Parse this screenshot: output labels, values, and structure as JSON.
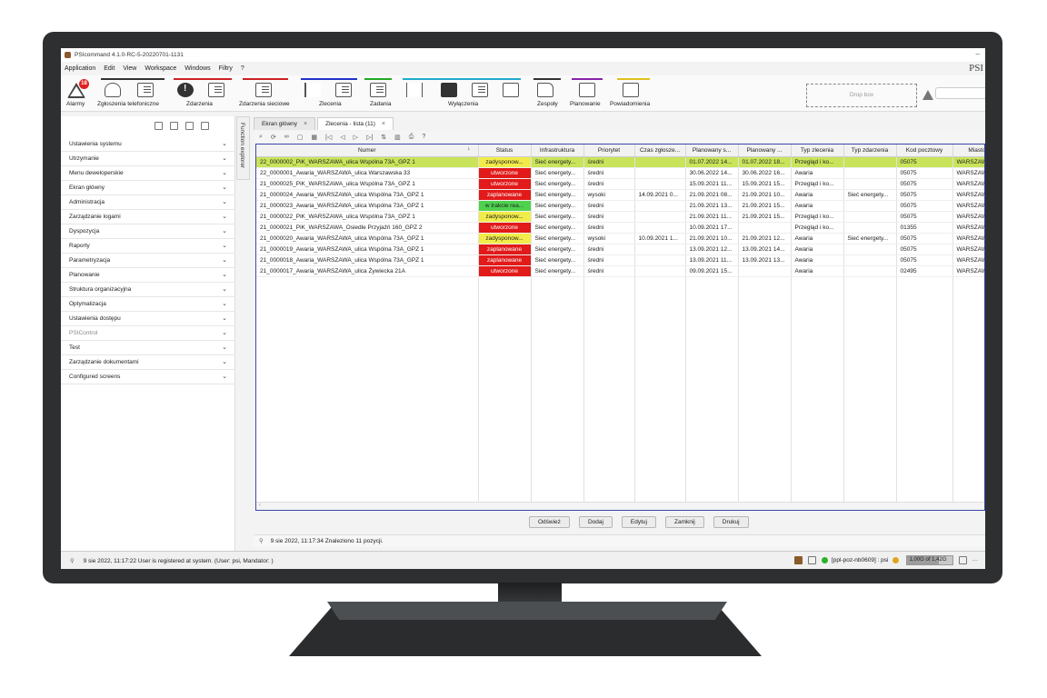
{
  "window": {
    "title": "PSIcommand 4.1.0-RC-5-20220701-1131",
    "brand": "PSI",
    "minimize_glyph": "–"
  },
  "menu": [
    "Application",
    "Edit",
    "View",
    "Workspace",
    "Windows",
    "Filtry",
    "?"
  ],
  "toolbar": {
    "groups": [
      {
        "label": "Alarmy",
        "badge": "18",
        "color": ""
      },
      {
        "label": "Zgłoszenia telefoniczne",
        "color": "#333333"
      },
      {
        "label": "Zdarzenia",
        "color": "#cc2222"
      },
      {
        "label": "Zdarzenia sieciowe",
        "color": "#cc2222"
      },
      {
        "label": "Zlecenia",
        "color": "#2233cc"
      },
      {
        "label": "Zadania",
        "color": "#22aa22"
      },
      {
        "label": "Wyłączenia",
        "color": "#22aacc"
      },
      {
        "label": "Zespoły",
        "color": "#333333"
      },
      {
        "label": "Planowanie",
        "color": "#8822aa"
      },
      {
        "label": "Powiadomienia",
        "color": "#e0c020"
      }
    ],
    "dropbox": "Drop box"
  },
  "sidebar": {
    "explorer_tab": "Function explorer",
    "items": [
      {
        "label": "Ustawienia systemu",
        "disabled": false
      },
      {
        "label": "Utrzymanie",
        "disabled": false
      },
      {
        "label": "Menu deweloperskie",
        "disabled": false
      },
      {
        "label": "Ekran główny",
        "disabled": false
      },
      {
        "label": "Administracja",
        "disabled": false
      },
      {
        "label": "Zarządzanie logami",
        "disabled": false
      },
      {
        "label": "Dyspozycja",
        "disabled": false
      },
      {
        "label": "Raporty",
        "disabled": false
      },
      {
        "label": "Parametryzacja",
        "disabled": false
      },
      {
        "label": "Planowanie",
        "disabled": false
      },
      {
        "label": "Struktura organizacyjna",
        "disabled": false
      },
      {
        "label": "Optymalizacja",
        "disabled": false
      },
      {
        "label": "Ustawienia dostępu",
        "disabled": false
      },
      {
        "label": "PSIControl",
        "disabled": true
      },
      {
        "label": "Test",
        "disabled": false
      },
      {
        "label": "Zarządzanie dokumentami",
        "disabled": false
      },
      {
        "label": "Configured screens",
        "disabled": false
      }
    ]
  },
  "tabs": [
    {
      "label": "Ekran główny",
      "active": false
    },
    {
      "label": "Zlecenia - lista (11)",
      "active": true
    }
  ],
  "table": {
    "sort_glyph": "↓",
    "columns": [
      "Numer",
      "Status",
      "Infrastruktura",
      "Priorytet",
      "Czas zgłosze...",
      "Planowany s...",
      "Planowany ...",
      "Typ zlecenia",
      "Typ zdarzenia",
      "Kod pocztowy",
      "Miasto"
    ],
    "rows": [
      {
        "selected": true,
        "status_class": "st-zadysponowane",
        "cells": [
          "22_0000002_PiK_WARSZAWA_ulica Wspólna 73A_GPZ 1",
          "zadysponow...",
          "Sieć energety...",
          "średni",
          "",
          "01.07.2022 14...",
          "01.07.2022 18...",
          "Przegląd i ko...",
          "",
          "05075",
          "WARSZAWA"
        ]
      },
      {
        "selected": false,
        "status_class": "st-utworzone",
        "cells": [
          "22_0000001_Awaria_WARSZAWA_ulica Warszawska 33",
          "utworzone",
          "Sieć energety...",
          "średni",
          "",
          "30.06.2022 14...",
          "30.06.2022 16...",
          "Awaria",
          "",
          "05075",
          "WARSZAWA"
        ]
      },
      {
        "selected": false,
        "status_class": "st-utworzone",
        "cells": [
          "21_0000025_PiK_WARSZAWA_ulica Wspólna 73A_GPZ 1",
          "utworzone",
          "Sieć energety...",
          "średni",
          "",
          "15.09.2021 11...",
          "15.09.2021 15...",
          "Przegląd i ko...",
          "",
          "05075",
          "WARSZAWA"
        ]
      },
      {
        "selected": false,
        "status_class": "st-zaplanowane",
        "cells": [
          "21_0000024_Awaria_WARSZAWA_ulica Wspólna 73A_GPZ 1",
          "zaplanowane",
          "Sieć energety...",
          "wysoki",
          "14.09.2021 0...",
          "21.09.2021 08...",
          "21.09.2021 10...",
          "Awaria",
          "Sieć energety...",
          "05075",
          "WARSZAWA"
        ]
      },
      {
        "selected": false,
        "status_class": "st-wtrakcie",
        "cells": [
          "21_0000023_Awaria_WARSZAWA_ulica Wspólna 73A_GPZ 1",
          "w trakcie rea...",
          "Sieć energety...",
          "średni",
          "",
          "21.09.2021 13...",
          "21.09.2021 15...",
          "Awaria",
          "",
          "05075",
          "WARSZAWA"
        ]
      },
      {
        "selected": false,
        "status_class": "st-zadysponowane",
        "cells": [
          "21_0000022_PiK_WARSZAWA_ulica Wspólna 73A_GPZ 1",
          "zadysponow...",
          "Sieć energety...",
          "średni",
          "",
          "21.09.2021 11...",
          "21.09.2021 15...",
          "Przegląd i ko...",
          "",
          "05075",
          "WARSZAWA"
        ]
      },
      {
        "selected": false,
        "status_class": "st-utworzone",
        "cells": [
          "21_0000021_PiK_WARSZAWA_Osiedle Przyjaźń 160_GPZ 2",
          "utworzone",
          "Sieć energety...",
          "średni",
          "",
          "10.09.2021 17...",
          "",
          "Przegląd i ko...",
          "",
          "01355",
          "WARSZAWA"
        ]
      },
      {
        "selected": false,
        "status_class": "st-zadysponowane",
        "cells": [
          "21_0000020_Awaria_WARSZAWA_ulica Wspólna 73A_GPZ 1",
          "zadysponow...",
          "Sieć energety...",
          "wysoki",
          "10.09.2021 1...",
          "21.09.2021 10...",
          "21.09.2021 12...",
          "Awaria",
          "Sieć energety...",
          "05075",
          "WARSZAWA"
        ]
      },
      {
        "selected": false,
        "status_class": "st-zaplanowane",
        "cells": [
          "21_0000019_Awaria_WARSZAWA_ulica Wspólna 73A_GPZ 1",
          "zaplanowane",
          "Sieć energety...",
          "średni",
          "",
          "13.09.2021 12...",
          "13.09.2021 14...",
          "Awaria",
          "",
          "05075",
          "WARSZAWA"
        ]
      },
      {
        "selected": false,
        "status_class": "st-zaplanowane",
        "cells": [
          "21_0000018_Awaria_WARSZAWA_ulica Wspólna 73A_GPZ 1",
          "zaplanowane",
          "Sieć energety...",
          "średni",
          "",
          "13.09.2021 11...",
          "13.09.2021 13...",
          "Awaria",
          "",
          "05075",
          "WARSZAWA"
        ]
      },
      {
        "selected": false,
        "status_class": "st-utworzone",
        "cells": [
          "21_0000017_Awaria_WARSZAWA_ulica Żywiecka 21A",
          "utworzone",
          "Sieć energety...",
          "średni",
          "",
          "09.09.2021 15...",
          "",
          "Awaria",
          "",
          "02495",
          "WARSZAWA"
        ]
      }
    ]
  },
  "buttons": [
    "Odśwież",
    "Dodaj",
    "Edytuj",
    "Zamknij",
    "Drukuj"
  ],
  "message_bar": "9 sie 2022, 11:17:34  Znaleziono 11 pozycji.",
  "status_bar": {
    "message": "9 sie 2022, 11:17:22  User is registered at system. (User: psi, Mandator: )",
    "server": "[ppl-poz-nb0609] : psi",
    "memory": "1,00G of 1,42G",
    "memory_used_fraction": 0.7,
    "more": "···"
  }
}
